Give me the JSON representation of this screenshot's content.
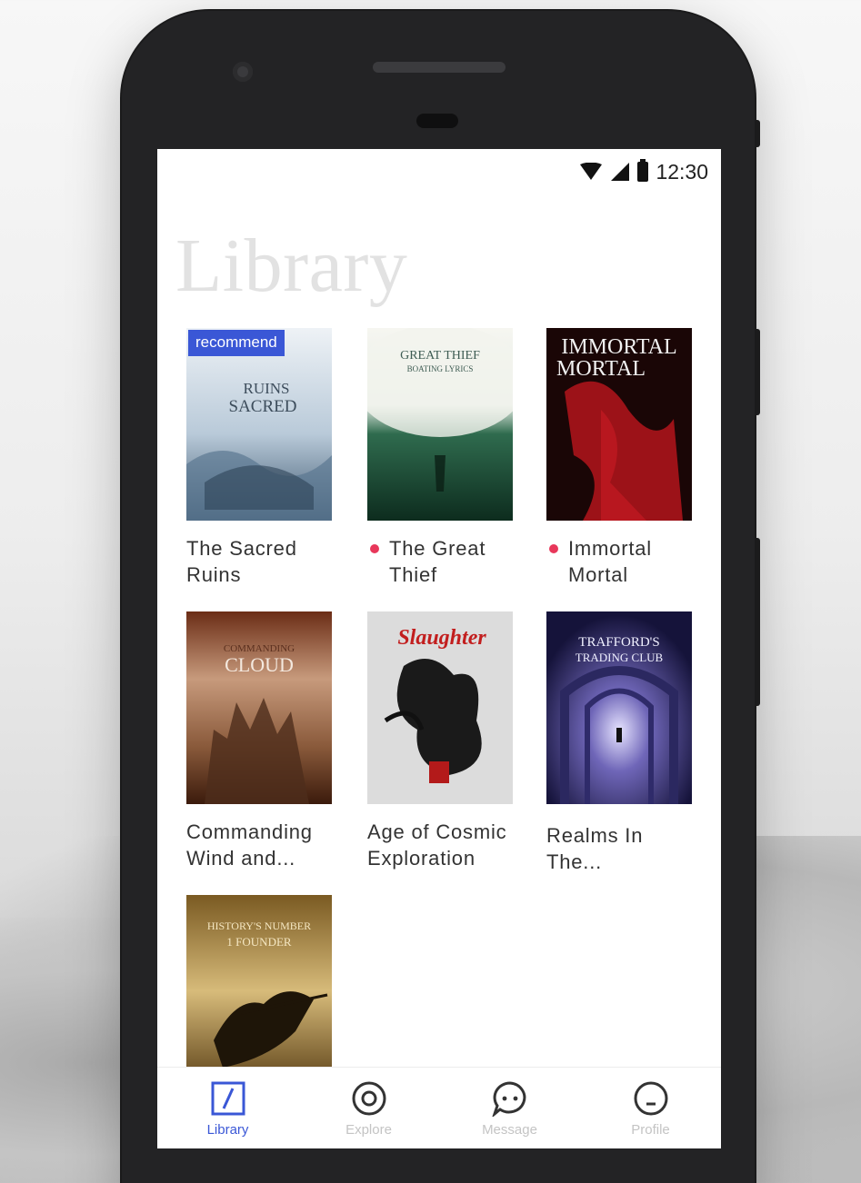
{
  "status_bar": {
    "time": "12:30"
  },
  "page": {
    "title": "Library"
  },
  "books": [
    {
      "title_line1": "The Sacred",
      "title_line2": "Ruins",
      "badge": "recommend",
      "has_update": false,
      "cover_text": [
        "RUINS",
        "SACRED"
      ]
    },
    {
      "title_line1": "The Great",
      "title_line2": "Thief",
      "has_update": true,
      "cover_text": [
        "GREAT THIEF",
        "BOATING LYRICS"
      ]
    },
    {
      "title_line1": "Immortal",
      "title_line2": "Mortal",
      "has_update": true,
      "cover_text": [
        "IMMORTAL",
        "MORTAL"
      ]
    },
    {
      "title_line1": "Commanding",
      "title_line2": "Wind and...",
      "has_update": false,
      "cover_text": [
        "COMMANDING",
        "CLOUD"
      ]
    },
    {
      "title_line1": "Age of Cosmic",
      "title_line2": "Exploration",
      "has_update": false,
      "cover_text": [
        "Slaughter"
      ]
    },
    {
      "title_line1": "Realms In",
      "title_line2": "The...",
      "has_update": false,
      "cover_text": [
        "TRAFFORD'S",
        "TRADING CLUB"
      ]
    },
    {
      "title_line1": "",
      "title_line2": "",
      "has_update": false,
      "cover_text": [
        "HISTORY'S NUMBER",
        "1 FOUNDER"
      ]
    }
  ],
  "tabs": [
    {
      "label": "Library",
      "icon": "library-icon",
      "active": true
    },
    {
      "label": "Explore",
      "icon": "explore-icon",
      "active": false
    },
    {
      "label": "Message",
      "icon": "message-icon",
      "active": false
    },
    {
      "label": "Profile",
      "icon": "profile-icon",
      "active": false
    }
  ],
  "colors": {
    "accent": "#3a57d6",
    "update_dot": "#e8375a",
    "title_watermark": "#e2e2e2"
  }
}
